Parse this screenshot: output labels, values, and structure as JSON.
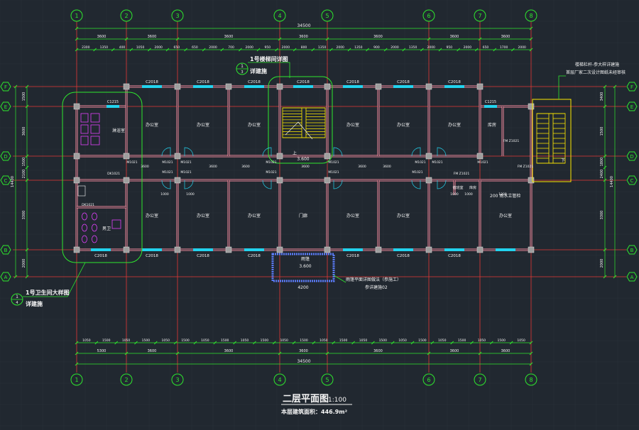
{
  "drawing": {
    "title": "二层平面图",
    "scale": "1:100",
    "area_note": "本层建筑面积：446.9m²"
  },
  "axes": {
    "vertical": [
      "1",
      "2",
      "3",
      "4",
      "5",
      "6",
      "7",
      "8"
    ],
    "horizontal": [
      "F",
      "E",
      "D",
      "C",
      "B",
      "A"
    ]
  },
  "dimensions": {
    "total_width": "34500",
    "top_bays": [
      "3600",
      "3600",
      "3600",
      "3600",
      "3600",
      "3600",
      "3600"
    ],
    "top_detail": [
      "2300",
      "1350",
      "400",
      "1050",
      "2000",
      "650",
      "650",
      "2000",
      "700",
      "2000",
      "950",
      "2000",
      "800",
      "1350",
      "2000",
      "1350",
      "900",
      "2000",
      "1350",
      "2000",
      "950",
      "2000",
      "650",
      "1700",
      "2000"
    ],
    "bottom_detail": [
      "1050",
      "1500",
      "1050",
      "1500",
      "1050",
      "1500",
      "1050",
      "1500",
      "1050",
      "1500",
      "1050",
      "1500",
      "1050",
      "1500",
      "1050",
      "1500",
      "1050",
      "1500",
      "1050",
      "1500",
      "1050",
      "1500",
      "1050"
    ],
    "bottom_bays": [
      "5300",
      "3600",
      "3600",
      "3600",
      "3600",
      "3600",
      "3600"
    ],
    "left_side": [
      "1500",
      "3600",
      "1500",
      "2100",
      "3300",
      "2000"
    ],
    "left_total": "14400",
    "right_side": [
      "3400",
      "1500",
      "1800",
      "2400",
      "3300",
      "2000"
    ],
    "right_total": "14400",
    "right_top": "3850"
  },
  "windows": {
    "top": [
      "C2018",
      "C2018",
      "C2018",
      "C2018",
      "C2018",
      "C2018",
      "C2018"
    ],
    "bottom": [
      "C2018",
      "C2018",
      "C2018",
      "C2018",
      "C2018",
      "C2018",
      "C2018"
    ],
    "small": "C1215",
    "small2": "C1215"
  },
  "rooms": {
    "office": "办公室",
    "toilet_m": "男卫",
    "washroom": "淋浴室",
    "stair": "楼梯",
    "duty": "值班室",
    "storage": "库房",
    "balcony": "门廊",
    "up": "上",
    "down": "下"
  },
  "doors": [
    "M1021",
    "M1021",
    "M1021",
    "M1021",
    "M1021",
    "M1021",
    "M1021",
    "M1021",
    "M1021",
    "M1021",
    "M1021",
    "M1021",
    "FM Z1021",
    "FM Z1021",
    "FM Z1021",
    "DK1021",
    "DK1021",
    "M1021"
  ],
  "corridor_dims": [
    "3600",
    "3600",
    "3600",
    "3600",
    "3600",
    "3600",
    "1000",
    "1000",
    "1000",
    "1000",
    "1200"
  ],
  "annotations": {
    "stair_ref": "1号楼梯间详图",
    "stair_ref_sub": "详建施",
    "toilet_ref": "1号卫生间大样图",
    "toilet_ref_sub": "详建施",
    "right_note_1": "楼梯栏杆-参大样详建施",
    "right_note_2": "首层厂家二次设计图纸未经审核",
    "canopy_note": "雨篷",
    "canopy_elev": "3.600",
    "canopy_dim": "4200",
    "canopy_ref": "雨篷平面详图做法（参施工）",
    "canopy_ref_2": "参详建施02",
    "corridor_elev": "3.600",
    "util_note": "200 雨水立管检",
    "bubble_1": "1",
    "bubble_1_sub": "3",
    "bubble_2": "1",
    "bubble_2_sub": "4"
  },
  "colors": {
    "background": "#212830",
    "axis_line": "#e53935",
    "axis_bubble": "#2ee82e",
    "wall": "#e8e8e8",
    "window": "#22d3ee",
    "dim": "#2ee82e",
    "stair": "#ffea00",
    "fixture": "#e040fb",
    "text": "#f5f5f5"
  }
}
